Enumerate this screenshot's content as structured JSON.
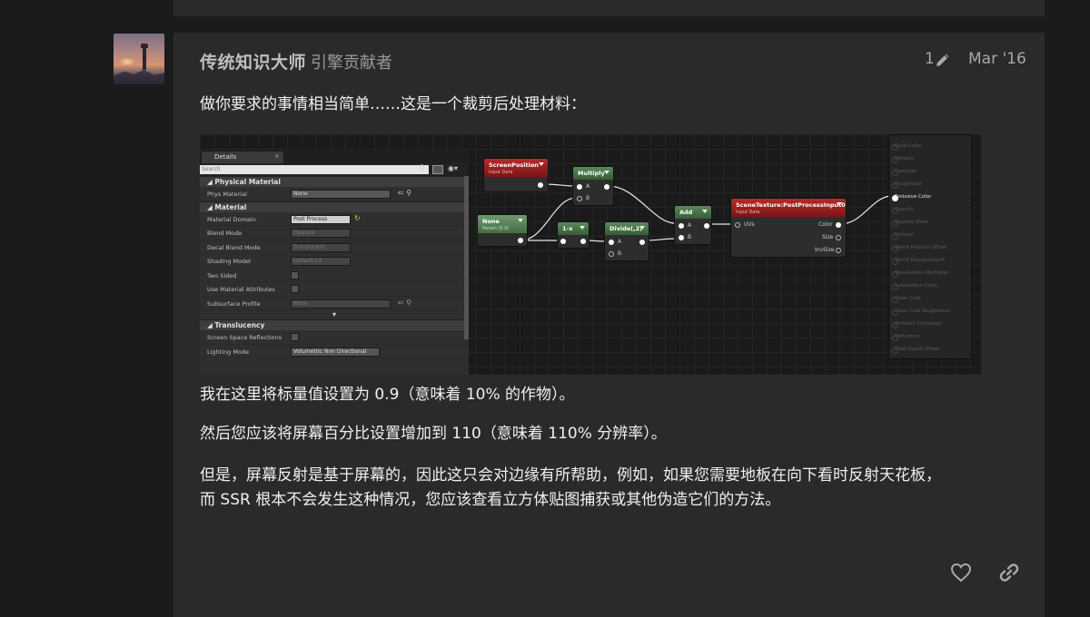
{
  "post": {
    "username": "传统知识大师",
    "user_title": "引擎贡献者",
    "edit_count": "1",
    "date": "Mar '16",
    "paragraphs": [
      "做你要求的事情相当简单……这是一个裁剪后处理材料：",
      "我在这里将标量值设置为 0.9（意味着 10% 的作物）。",
      "然后您应该将屏幕百分比设置增加到 110（意味着 110% 分辨率）。",
      "但是，屏幕反射是基于屏幕的，因此这只会对边缘有所帮助，例如，如果您需要地板在向下看时反射天花板，",
      "而 SSR 根本不会发生这种情况，您应该查看立方体贴图捕获或其他伪造它们的方法。"
    ]
  },
  "editor_image": {
    "details": {
      "tab": "Details",
      "search_placeholder": "Search",
      "sections": {
        "physical": "Physical Material",
        "material": "Material",
        "translucency": "Translucency"
      },
      "rows": {
        "phys_material": {
          "label": "Phys Material",
          "value": "None"
        },
        "material_domain": {
          "label": "Material Domain",
          "value": "Post Process"
        },
        "blend_mode": {
          "label": "Blend Mode",
          "value": "Opaque"
        },
        "decal_blend_mode": {
          "label": "Decal Blend Mode",
          "value": "Translucent"
        },
        "shading_model": {
          "label": "Shading Model",
          "value": "Default Lit"
        },
        "two_sided": {
          "label": "Two Sided"
        },
        "use_material_attributes": {
          "label": "Use Material Attributes"
        },
        "subsurface_profile": {
          "label": "Subsurface Profile",
          "value": "None"
        },
        "screen_space_reflections": {
          "label": "Screen Space Reflections"
        },
        "lighting_mode": {
          "label": "Lighting Mode",
          "value": "Volumetric Non Directional"
        }
      }
    },
    "nodes": {
      "screen_position": {
        "title": "ScreenPosition",
        "subtitle": "Input Data"
      },
      "multiply": {
        "title": "Multiply",
        "pin_a": "A",
        "pin_b": "B"
      },
      "none_param": {
        "title": "None",
        "subtitle": "Param (0.9)"
      },
      "one_minus": {
        "title": "1-x"
      },
      "divide": {
        "title": "Divide(,2)",
        "pin_a": "A",
        "pin_b": "B"
      },
      "add": {
        "title": "Add",
        "pin_a": "A",
        "pin_b": "B"
      },
      "scene_texture": {
        "title": "SceneTexture:PostProcessInput0",
        "subtitle": "Input Data",
        "in_uvs": "UVs",
        "out_color": "Color",
        "out_size": "Size",
        "out_invsize": "InvSize"
      }
    },
    "result_pins": [
      "Base Color",
      "Metallic",
      "Specular",
      "Roughness",
      "Emissive Color",
      "Opacity",
      "Opacity Mask",
      "Normal",
      "World Position Offset",
      "World Displacement",
      "Tessellation Multiplier",
      "Subsurface Color",
      "Clear Coat",
      "Clear Coat Roughness",
      "Ambient Occlusion",
      "Refraction",
      "Pixel Depth Offset"
    ],
    "active_result_pin": "Emissive Color"
  },
  "colors": {
    "page_bg": "#1b1b1b",
    "post_bg": "#2a2a2a",
    "node_red": "#b82a2a",
    "node_green": "#5a8a5a"
  },
  "icons": {
    "edit": "pencil-icon",
    "like": "heart-icon",
    "share": "link-icon"
  }
}
